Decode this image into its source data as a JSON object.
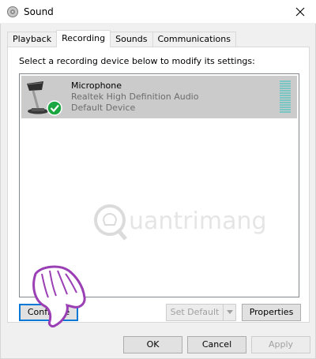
{
  "window": {
    "title": "Sound"
  },
  "tabs": [
    {
      "label": "Playback"
    },
    {
      "label": "Recording"
    },
    {
      "label": "Sounds"
    },
    {
      "label": "Communications"
    }
  ],
  "instruction": "Select a recording device below to modify its settings:",
  "device": {
    "name": "Microphone",
    "driver": "Realtek High Definition Audio",
    "status": "Default Device",
    "icon": "microphone-icon",
    "badge_icon": "default-device-check-icon"
  },
  "watermark": {
    "text": "uantrimang"
  },
  "buttons": {
    "configure": "Configure",
    "set_default": "Set Default",
    "properties": "Properties",
    "ok": "OK",
    "cancel": "Cancel",
    "apply": "Apply"
  },
  "colors": {
    "accent": "#0078d7",
    "selected_row": "#cbcbcb",
    "level_meter": "#7ac6c4",
    "check_badge": "#1aa640",
    "hand_cursor": "#9b3fb5"
  }
}
